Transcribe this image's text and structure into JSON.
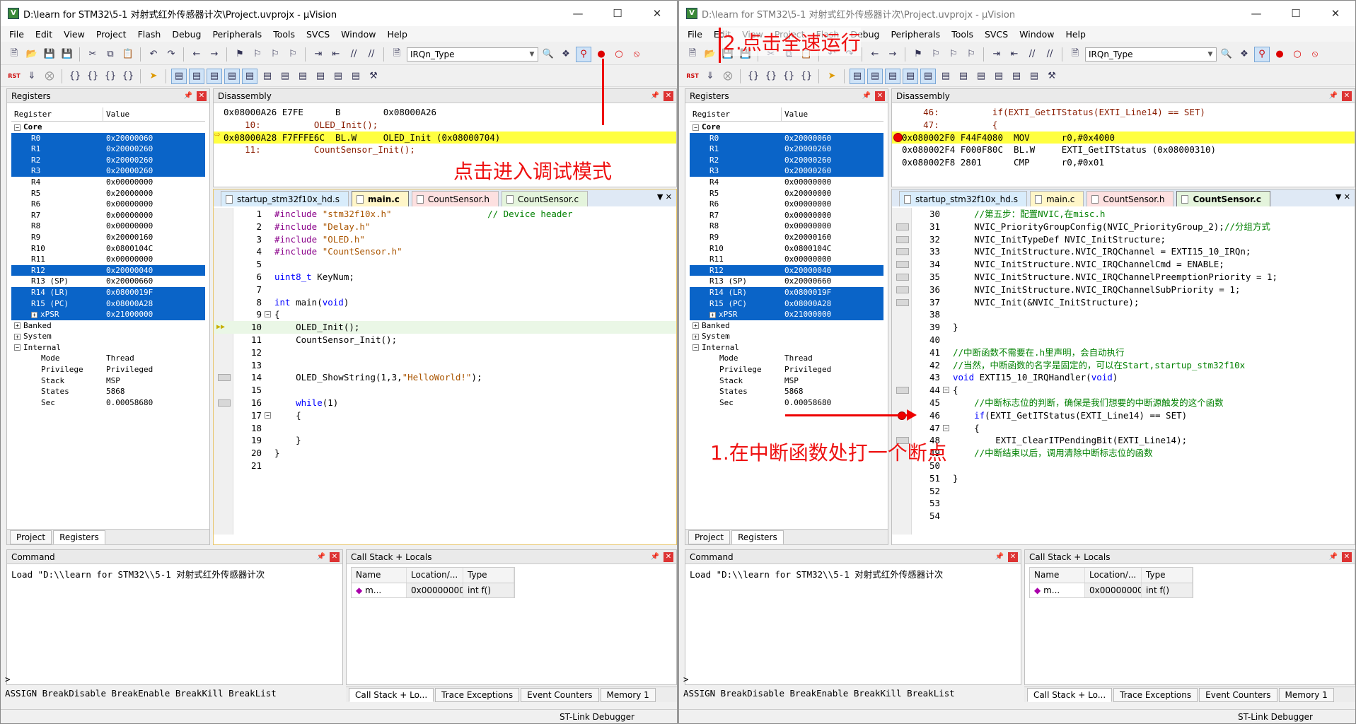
{
  "window_title": "D:\\learn for STM32\\5-1 对射式红外传感器计次\\Project.uvprojx - µVision",
  "menu": [
    "File",
    "Edit",
    "View",
    "Project",
    "Flash",
    "Debug",
    "Peripherals",
    "Tools",
    "SVCS",
    "Window",
    "Help"
  ],
  "target_combo": "IRQn_Type",
  "panes": {
    "registers": "Registers",
    "disassembly": "Disassembly",
    "command": "Command",
    "callstack": "Call Stack + Locals"
  },
  "reg_columns": [
    "Register",
    "Value"
  ],
  "registers": [
    {
      "name": "Core",
      "value": "",
      "level": 0,
      "toggle": "-",
      "bold": true
    },
    {
      "name": "R0",
      "value": "0x20000060",
      "level": 1,
      "sel": true
    },
    {
      "name": "R1",
      "value": "0x20000260",
      "level": 1,
      "sel": true
    },
    {
      "name": "R2",
      "value": "0x20000260",
      "level": 1,
      "sel": true
    },
    {
      "name": "R3",
      "value": "0x20000260",
      "level": 1,
      "sel": true
    },
    {
      "name": "R4",
      "value": "0x00000000",
      "level": 1
    },
    {
      "name": "R5",
      "value": "0x20000000",
      "level": 1
    },
    {
      "name": "R6",
      "value": "0x00000000",
      "level": 1
    },
    {
      "name": "R7",
      "value": "0x00000000",
      "level": 1
    },
    {
      "name": "R8",
      "value": "0x00000000",
      "level": 1
    },
    {
      "name": "R9",
      "value": "0x20000160",
      "level": 1
    },
    {
      "name": "R10",
      "value": "0x0800104C",
      "level": 1
    },
    {
      "name": "R11",
      "value": "0x00000000",
      "level": 1
    },
    {
      "name": "R12",
      "value": "0x20000040",
      "level": 1,
      "sel": true
    },
    {
      "name": "R13 (SP)",
      "value": "0x20000660",
      "level": 1
    },
    {
      "name": "R14 (LR)",
      "value": "0x0800019F",
      "level": 1,
      "sel": true
    },
    {
      "name": "R15 (PC)",
      "value": "0x08000A28",
      "level": 1,
      "sel": true
    },
    {
      "name": "xPSR",
      "value": "0x21000000",
      "level": 1,
      "sel": true,
      "toggle": "+"
    },
    {
      "name": "Banked",
      "value": "",
      "level": 0,
      "toggle": "+"
    },
    {
      "name": "System",
      "value": "",
      "level": 0,
      "toggle": "+"
    },
    {
      "name": "Internal",
      "value": "",
      "level": 0,
      "toggle": "-"
    },
    {
      "name": "Mode",
      "value": "Thread",
      "level": 2
    },
    {
      "name": "Privilege",
      "value": "Privileged",
      "level": 2
    },
    {
      "name": "Stack",
      "value": "MSP",
      "level": 2
    },
    {
      "name": "States",
      "value": "5868",
      "level": 2
    },
    {
      "name": "Sec",
      "value": "0.00058680",
      "level": 2
    }
  ],
  "bottom_tabs": [
    "Project",
    "Registers"
  ],
  "left": {
    "disasm": [
      {
        "t": "0x08000A26 E7FE      B        0x08000A26",
        "cls": ""
      },
      {
        "t": "    10:          OLED_Init();",
        "cls": "src"
      },
      {
        "t": "0x08000A28 F7FFFE6C  BL.W     OLED_Init (0x08000704)",
        "cls": "hl"
      },
      {
        "t": "    11:          CountSensor_Init();",
        "cls": "src"
      }
    ],
    "editor_tabs": [
      "startup_stm32f10x_hd.s",
      "main.c",
      "CountSensor.h",
      "CountSensor.c"
    ],
    "active_tab": 1,
    "code": [
      {
        "n": "1",
        "t": "#include \"stm32f10x.h\"                  // Device header"
      },
      {
        "n": "2",
        "t": "#include \"Delay.h\""
      },
      {
        "n": "3",
        "t": "#include \"OLED.h\""
      },
      {
        "n": "4",
        "t": "#include \"CountSensor.h\""
      },
      {
        "n": "5",
        "t": ""
      },
      {
        "n": "6",
        "t": "uint8_t KeyNum;"
      },
      {
        "n": "7",
        "t": ""
      },
      {
        "n": "8",
        "t": "int main(void)"
      },
      {
        "n": "9",
        "t": "{"
      },
      {
        "n": "10",
        "t": "    OLED_Init();"
      },
      {
        "n": "11",
        "t": "    CountSensor_Init();"
      },
      {
        "n": "12",
        "t": ""
      },
      {
        "n": "13",
        "t": ""
      },
      {
        "n": "14",
        "t": "    OLED_ShowString(1,3,\"HelloWorld!\");"
      },
      {
        "n": "15",
        "t": ""
      },
      {
        "n": "16",
        "t": "    while(1)"
      },
      {
        "n": "17",
        "t": "    {"
      },
      {
        "n": "18",
        "t": ""
      },
      {
        "n": "19",
        "t": "    }"
      },
      {
        "n": "20",
        "t": "}"
      },
      {
        "n": "21",
        "t": ""
      }
    ],
    "annotation": "点击进入调试模式"
  },
  "right": {
    "disasm": [
      {
        "t": "    46:          if(EXTI_GetITStatus(EXTI_Line14) == SET)",
        "cls": "src"
      },
      {
        "t": "    47:          {",
        "cls": "src"
      },
      {
        "t": "0x080002F0 F44F4080  MOV      r0,#0x4000",
        "cls": "hl"
      },
      {
        "t": "0x080002F4 F000F80C  BL.W     EXTI_GetITStatus (0x08000310)",
        "cls": ""
      },
      {
        "t": "0x080002F8 2801      CMP      r0,#0x01",
        "cls": ""
      }
    ],
    "editor_tabs": [
      "startup_stm32f10x_hd.s",
      "main.c",
      "CountSensor.h",
      "CountSensor.c"
    ],
    "active_tab": 3,
    "code": [
      {
        "n": "30",
        "t": "    //第五步：配置NVIC,在misc.h"
      },
      {
        "n": "31",
        "t": "    NVIC_PriorityGroupConfig(NVIC_PriorityGroup_2);//分组方式"
      },
      {
        "n": "32",
        "t": "    NVIC_InitTypeDef NVIC_InitStructure;"
      },
      {
        "n": "33",
        "t": "    NVIC_InitStructure.NVIC_IRQChannel = EXTI15_10_IRQn;"
      },
      {
        "n": "34",
        "t": "    NVIC_InitStructure.NVIC_IRQChannelCmd = ENABLE;"
      },
      {
        "n": "35",
        "t": "    NVIC_InitStructure.NVIC_IRQChannelPreemptionPriority = 1;"
      },
      {
        "n": "36",
        "t": "    NVIC_InitStructure.NVIC_IRQChannelSubPriority = 1;"
      },
      {
        "n": "37",
        "t": "    NVIC_Init(&NVIC_InitStructure);"
      },
      {
        "n": "38",
        "t": ""
      },
      {
        "n": "39",
        "t": "}"
      },
      {
        "n": "40",
        "t": ""
      },
      {
        "n": "41",
        "t": "//中断函数不需要在.h里声明，会自动执行"
      },
      {
        "n": "42",
        "t": "//当然，中断函数的名字是固定的，可以在Start,startup_stm32f10x"
      },
      {
        "n": "43",
        "t": "void EXTI15_10_IRQHandler(void)"
      },
      {
        "n": "44",
        "t": "{"
      },
      {
        "n": "45",
        "t": "    //中断标志位的判断，确保是我们想要的中断源触发的这个函数"
      },
      {
        "n": "46",
        "t": "    if(EXTI_GetITStatus(EXTI_Line14) == SET)"
      },
      {
        "n": "47",
        "t": "    {"
      },
      {
        "n": "48",
        "t": "        EXTI_ClearITPendingBit(EXTI_Line14);"
      },
      {
        "n": "49",
        "t": "    //中断结束以后，调用清除中断标志位的函数"
      },
      {
        "n": "50",
        "t": ""
      },
      {
        "n": "51",
        "t": "}"
      },
      {
        "n": "52",
        "t": ""
      },
      {
        "n": "53",
        "t": ""
      },
      {
        "n": "54",
        "t": ""
      }
    ],
    "annotation_top": "2.点击全速运行",
    "annotation_mid": "1.在中断函数处打一个断点"
  },
  "command_text": "Load \"D:\\\\learn for STM32\\\\5-1 对射式红外传感器计次",
  "command_prompt": ">",
  "command_hint": "ASSIGN BreakDisable BreakEnable BreakKill BreakList",
  "callstack_cols": [
    "Name",
    "Location/...",
    "Type"
  ],
  "callstack_row": [
    "m...",
    "0x00000000",
    "int f()"
  ],
  "bottom_right_tabs": [
    "Call Stack + Lo...",
    "Trace Exceptions",
    "Event Counters",
    "Memory 1"
  ],
  "status_right": "ST-Link Debugger"
}
